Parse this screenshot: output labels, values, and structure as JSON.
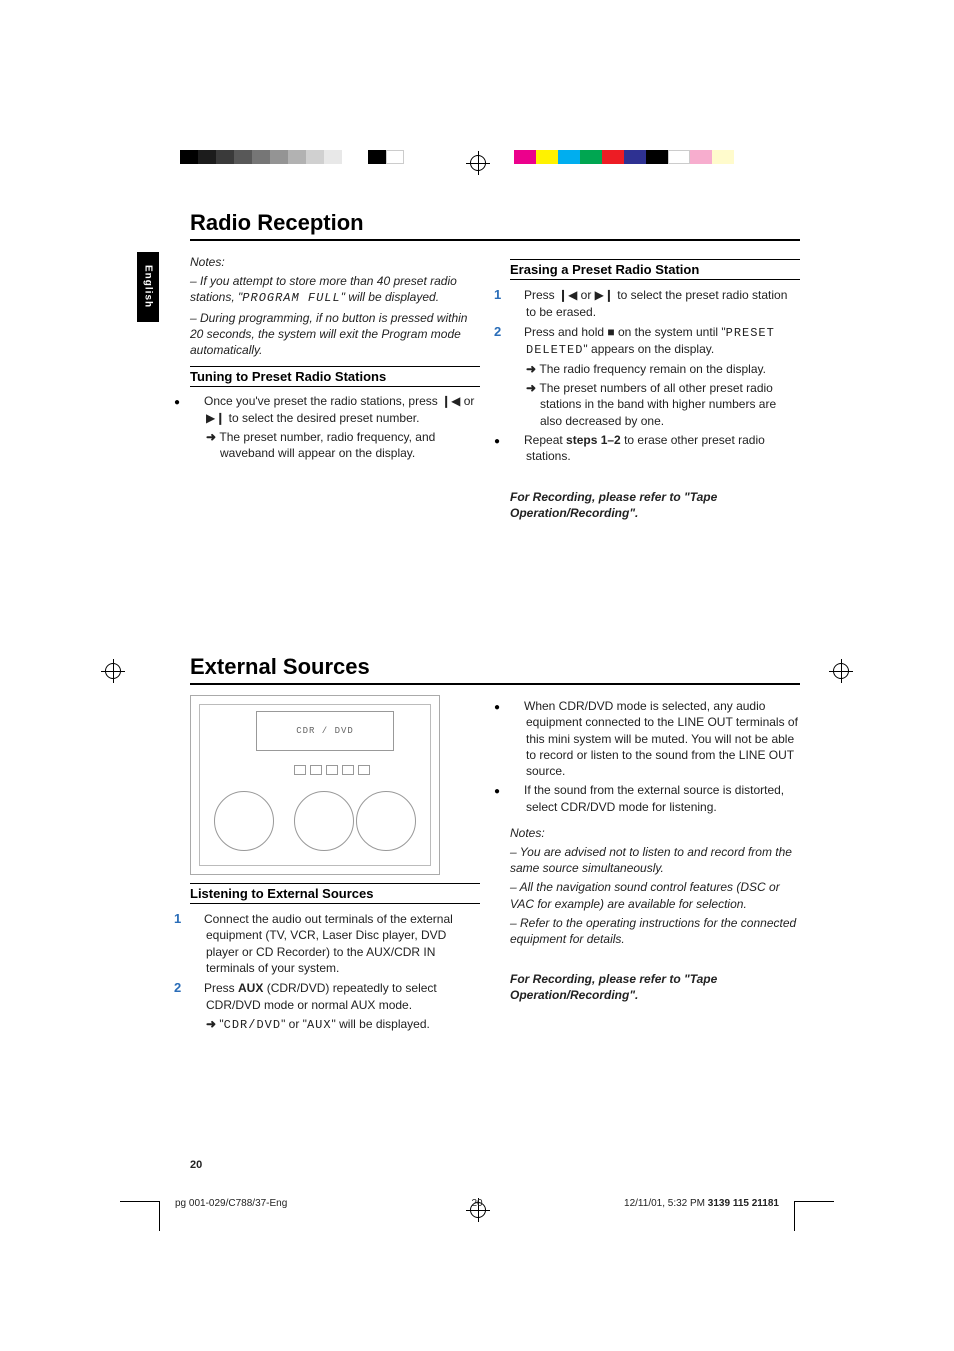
{
  "lang_tab": "English",
  "sections": {
    "radio": {
      "title": "Radio Reception",
      "notes_heading": "Notes:",
      "notes": [
        "If you attempt to store more than 40 preset radio stations, \"",
        "\" will be displayed.",
        "During programming, if no button is pressed within 20 seconds, the system will exit the Program mode automatically."
      ],
      "program_full_text": "PROGRAM FULL",
      "tuning": {
        "heading": "Tuning to Preset Radio Stations",
        "bullet_prefix": "Once you've preset the radio stations, press ",
        "bullet_middle": " or ",
        "bullet_suffix": " to select the desired preset number.",
        "arrow_text": "The preset number, radio frequency, and waveband will appear on the display."
      },
      "erasing": {
        "heading": "Erasing a Preset Radio Station",
        "step1_prefix": "Press ",
        "step1_middle": " or ",
        "step1_suffix": " to select the preset radio station to be erased.",
        "step2_prefix": "Press and hold ",
        "step2_mid": " on the system until \"",
        "step2_disp": "PRESET DELETED",
        "step2_suffix": "\" appears on the display.",
        "arrow_a": "The radio frequency remain on the display.",
        "arrow_b": "The preset numbers of all other preset radio stations in the band with higher numbers are also decreased by one.",
        "repeat_prefix": "Repeat ",
        "repeat_bold": "steps 1–2",
        "repeat_suffix": " to erase other preset radio stations.",
        "rec_note": "For Recording, please refer to \"Tape Operation/Recording\"."
      }
    },
    "external": {
      "title": "External Sources",
      "display_text": "CDR / DVD",
      "listening": {
        "heading": "Listening to External Sources",
        "step1": "Connect the audio out terminals of the external equipment (TV, VCR, Laser Disc player, DVD player or CD Recorder) to the AUX/CDR IN terminals of your system.",
        "step2_prefix": "Press ",
        "step2_bold": "AUX",
        "step2_suffix": " (CDR/DVD) repeatedly to select CDR/DVD mode or normal AUX mode.",
        "arrow_prefix": "\"",
        "arrow_disp1": "CDR/DVD",
        "arrow_mid": "\" or \"",
        "arrow_disp2": "AUX",
        "arrow_suffix": "\" will be displayed."
      },
      "right": {
        "bullet_a": "When CDR/DVD mode is selected, any audio equipment connected to the LINE OUT terminals of this mini system will be muted.  You will not be able to record or listen to the sound from the LINE OUT source.",
        "bullet_b": "If the sound from the external source is distorted, select CDR/DVD mode for listening.",
        "notes_heading": "Notes:",
        "note_a": "You are advised not to listen to and record from the same source simultaneously.",
        "note_b": "All the navigation sound control features (DSC or VAC for example) are available for selection.",
        "note_c": "Refer to the operating instructions for the connected equipment for details.",
        "rec_note": "For Recording, please refer to \"Tape Operation/Recording\"."
      }
    }
  },
  "page_number": "20",
  "footer": {
    "left": "pg 001-029/C788/37-Eng",
    "center": "20",
    "right_date": "12/11/01, 5:32 PM",
    "right_code": "3139 115 21181"
  },
  "icons": {
    "prev": "❙◀",
    "next": "▶❙",
    "stop": "■"
  }
}
